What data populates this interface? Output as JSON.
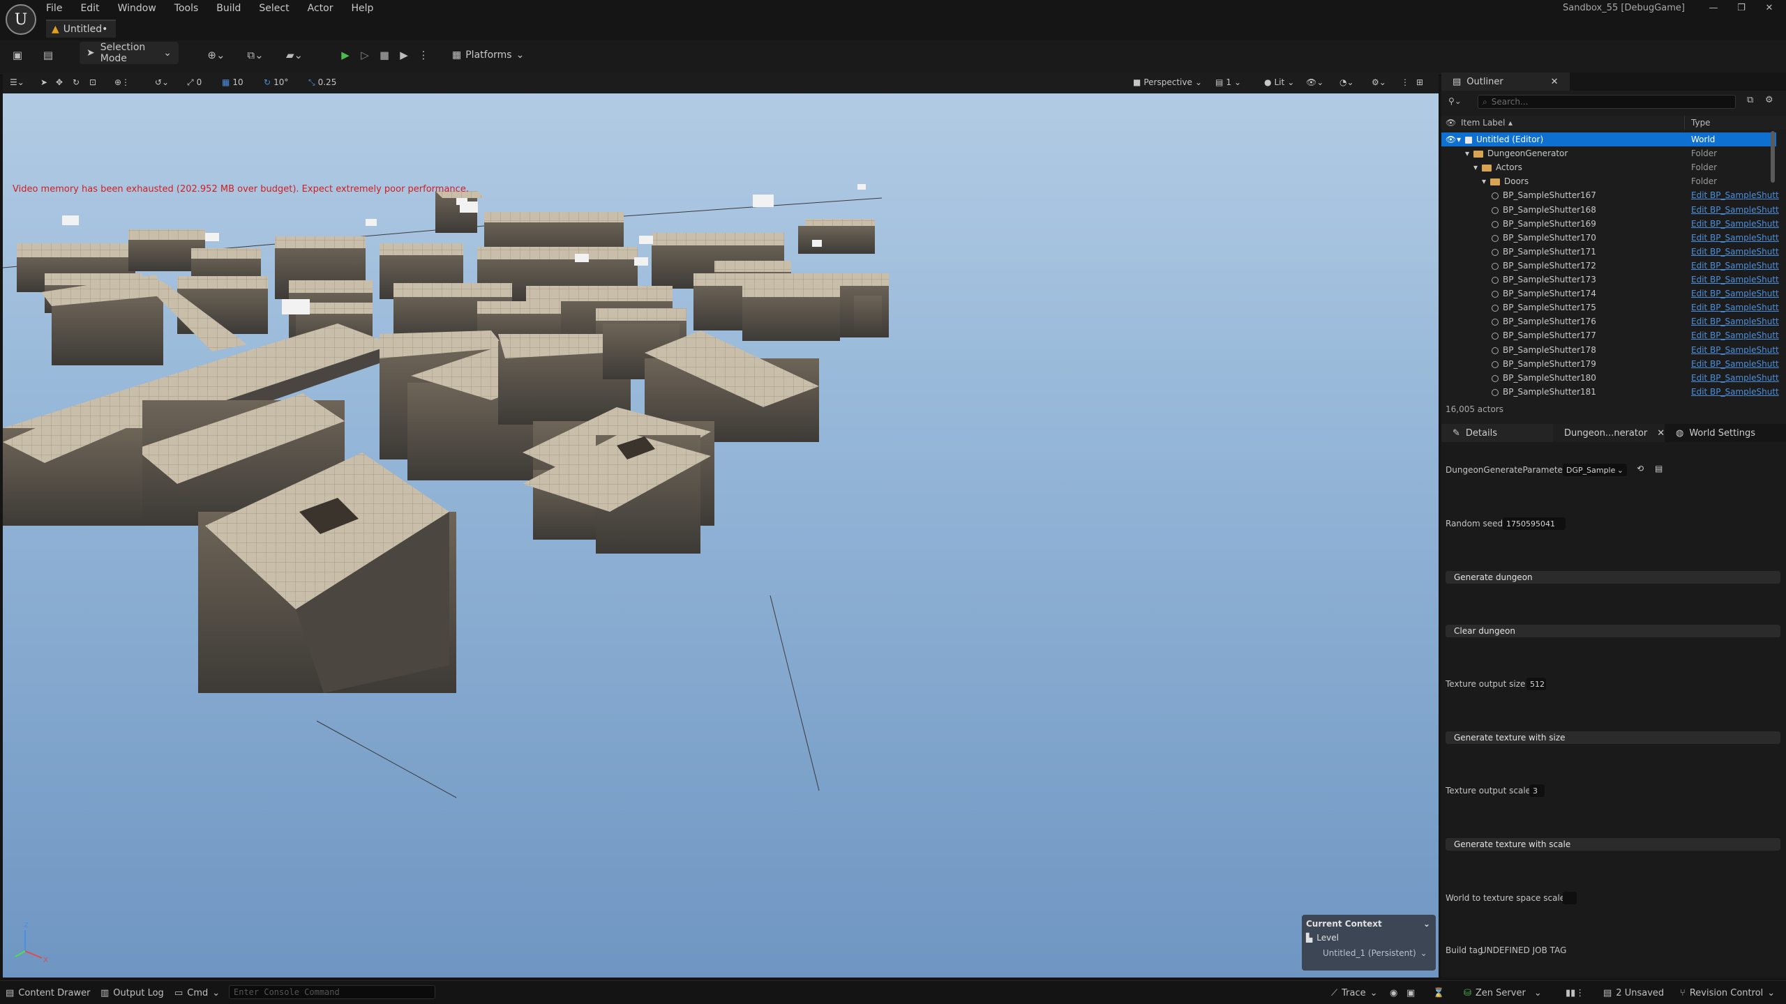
{
  "app": {
    "project_title": "Sandbox_55 [DebugGame]",
    "menu": [
      "File",
      "Edit",
      "Window",
      "Tools",
      "Build",
      "Select",
      "Actor",
      "Help"
    ],
    "document_tab": "Untitled•"
  },
  "toolbar": {
    "selection_mode": "Selection Mode",
    "platforms": "Platforms"
  },
  "viewport_toolbar": {
    "rotation_snap_left": "0",
    "grid_snap": "10",
    "rotation_snap": "10°",
    "scale_snap": "0.25",
    "view_mode": "Perspective",
    "layout_count": "1",
    "lighting": "Lit"
  },
  "viewport": {
    "warning": "Video memory has been exhausted (202.952 MB over budget). Expect extremely poor performance.",
    "current_context": {
      "title": "Current Context",
      "level_label": "Level",
      "level_value": "Untitled_1 (Persistent)"
    },
    "axis": {
      "x": "X",
      "z": "Z"
    }
  },
  "outliner": {
    "tab": "Outliner",
    "search_placeholder": "Search...",
    "col_label": "Item Label",
    "col_type": "Type",
    "rows": [
      {
        "label": "Untitled (Editor)",
        "type": "World",
        "depth": 0,
        "kind": "world",
        "selected": true
      },
      {
        "label": "DungeonGenerator",
        "type": "Folder",
        "depth": 1,
        "kind": "folder"
      },
      {
        "label": "Actors",
        "type": "Folder",
        "depth": 2,
        "kind": "folder"
      },
      {
        "label": "Doors",
        "type": "Folder",
        "depth": 3,
        "kind": "folder"
      },
      {
        "label": "BP_SampleShutter167",
        "type": "Edit BP_SampleShutt",
        "depth": 4,
        "kind": "actor"
      },
      {
        "label": "BP_SampleShutter168",
        "type": "Edit BP_SampleShutt",
        "depth": 4,
        "kind": "actor"
      },
      {
        "label": "BP_SampleShutter169",
        "type": "Edit BP_SampleShutt",
        "depth": 4,
        "kind": "actor"
      },
      {
        "label": "BP_SampleShutter170",
        "type": "Edit BP_SampleShutt",
        "depth": 4,
        "kind": "actor"
      },
      {
        "label": "BP_SampleShutter171",
        "type": "Edit BP_SampleShutt",
        "depth": 4,
        "kind": "actor"
      },
      {
        "label": "BP_SampleShutter172",
        "type": "Edit BP_SampleShutt",
        "depth": 4,
        "kind": "actor"
      },
      {
        "label": "BP_SampleShutter173",
        "type": "Edit BP_SampleShutt",
        "depth": 4,
        "kind": "actor"
      },
      {
        "label": "BP_SampleShutter174",
        "type": "Edit BP_SampleShutt",
        "depth": 4,
        "kind": "actor"
      },
      {
        "label": "BP_SampleShutter175",
        "type": "Edit BP_SampleShutt",
        "depth": 4,
        "kind": "actor"
      },
      {
        "label": "BP_SampleShutter176",
        "type": "Edit BP_SampleShutt",
        "depth": 4,
        "kind": "actor"
      },
      {
        "label": "BP_SampleShutter177",
        "type": "Edit BP_SampleShutt",
        "depth": 4,
        "kind": "actor"
      },
      {
        "label": "BP_SampleShutter178",
        "type": "Edit BP_SampleShutt",
        "depth": 4,
        "kind": "actor"
      },
      {
        "label": "BP_SampleShutter179",
        "type": "Edit BP_SampleShutt",
        "depth": 4,
        "kind": "actor"
      },
      {
        "label": "BP_SampleShutter180",
        "type": "Edit BP_SampleShutt",
        "depth": 4,
        "kind": "actor"
      },
      {
        "label": "BP_SampleShutter181",
        "type": "Edit BP_SampleShutt",
        "depth": 4,
        "kind": "actor"
      }
    ],
    "actor_count": "16,005 actors"
  },
  "details": {
    "tabs": [
      "Details",
      "Dungeon...nerator",
      "World Settings"
    ],
    "dungeon_generate_parameter_label": "DungeonGenerateParameter",
    "dungeon_generate_parameter_value": "DGP_Sample",
    "random_seed_label": "Random seed",
    "random_seed_value": "1750595041",
    "generate_dungeon": "Generate dungeon",
    "clear_dungeon": "Clear dungeon",
    "texture_output_size_label": "Texture output size",
    "texture_output_size_value": "512",
    "generate_texture_with_size": "Generate texture with size",
    "texture_output_scale_label": "Texture output scale",
    "texture_output_scale_value": "3",
    "generate_texture_with_scale": "Generate texture with scale",
    "world_to_texture_label": "World to texture space scale",
    "build_tag_label": "Build tag",
    "build_tag_value": "UNDEFINED JOB TAG"
  },
  "statusbar": {
    "content_drawer": "Content Drawer",
    "output_log": "Output Log",
    "cmd": "Cmd",
    "console_placeholder": "Enter Console Command",
    "trace": "Trace",
    "zen_server": "Zen Server",
    "unsaved": "2 Unsaved",
    "revision_control": "Revision Control"
  },
  "colors": {
    "accent": "#0e70d0",
    "warning": "#d21f1f",
    "play": "#4dba4d",
    "link": "#4b8fdc"
  }
}
